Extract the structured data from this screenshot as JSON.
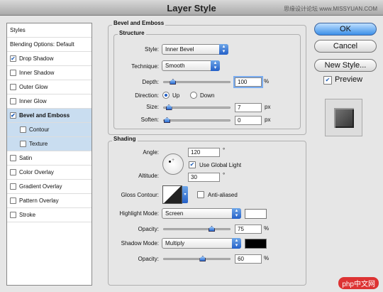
{
  "window": {
    "title": "Layer Style",
    "watermark": "思缘设计论坛 www.MISSYUAN.COM"
  },
  "left_list": {
    "items": [
      {
        "label": "Styles",
        "checked": null
      },
      {
        "label": "Blending Options: Default",
        "checked": null
      },
      {
        "label": "Drop Shadow",
        "checked": true
      },
      {
        "label": "Inner Shadow",
        "checked": false
      },
      {
        "label": "Outer Glow",
        "checked": false
      },
      {
        "label": "Inner Glow",
        "checked": false
      },
      {
        "label": "Bevel and Emboss",
        "checked": true
      },
      {
        "label": "Contour",
        "checked": false
      },
      {
        "label": "Texture",
        "checked": false
      },
      {
        "label": "Satin",
        "checked": false
      },
      {
        "label": "Color Overlay",
        "checked": false
      },
      {
        "label": "Gradient Overlay",
        "checked": false
      },
      {
        "label": "Pattern Overlay",
        "checked": false
      },
      {
        "label": "Stroke",
        "checked": false
      }
    ]
  },
  "bevel": {
    "section_title": "Bevel and Emboss",
    "structure_title": "Structure",
    "style_label": "Style:",
    "style_value": "Inner Bevel",
    "technique_label": "Technique:",
    "technique_value": "Smooth",
    "depth_label": "Depth:",
    "depth_value": "100",
    "depth_unit": "%",
    "depth_level": 0.1,
    "direction_label": "Direction:",
    "direction_up": "Up",
    "direction_down": "Down",
    "size_label": "Size:",
    "size_value": "7",
    "size_unit": "px",
    "size_level": 0.03,
    "soften_label": "Soften:",
    "soften_value": "0",
    "soften_unit": "px",
    "soften_level": 0.0
  },
  "shading": {
    "section_title": "Shading",
    "angle_label": "Angle:",
    "angle_value": "120",
    "angle_unit": "°",
    "global_light_label": "Use Global Light",
    "altitude_label": "Altitude:",
    "altitude_value": "30",
    "altitude_unit": "°",
    "gloss_label": "Gloss Contour:",
    "anti_aliased_label": "Anti-aliased",
    "highlight_mode_label": "Highlight Mode:",
    "highlight_mode_value": "Screen",
    "highlight_color": "#ffffff",
    "highlight_opacity_label": "Opacity:",
    "highlight_opacity_value": "75",
    "highlight_opacity_unit": "%",
    "highlight_opacity_level": 0.75,
    "shadow_mode_label": "Shadow Mode:",
    "shadow_mode_value": "Multiply",
    "shadow_color": "#000000",
    "shadow_opacity_label": "Opacity:",
    "shadow_opacity_value": "60",
    "shadow_opacity_unit": "%",
    "shadow_opacity_level": 0.6
  },
  "buttons": {
    "ok": "OK",
    "cancel": "Cancel",
    "new_style": "New Style...",
    "preview": "Preview"
  },
  "logo": "php中文网"
}
